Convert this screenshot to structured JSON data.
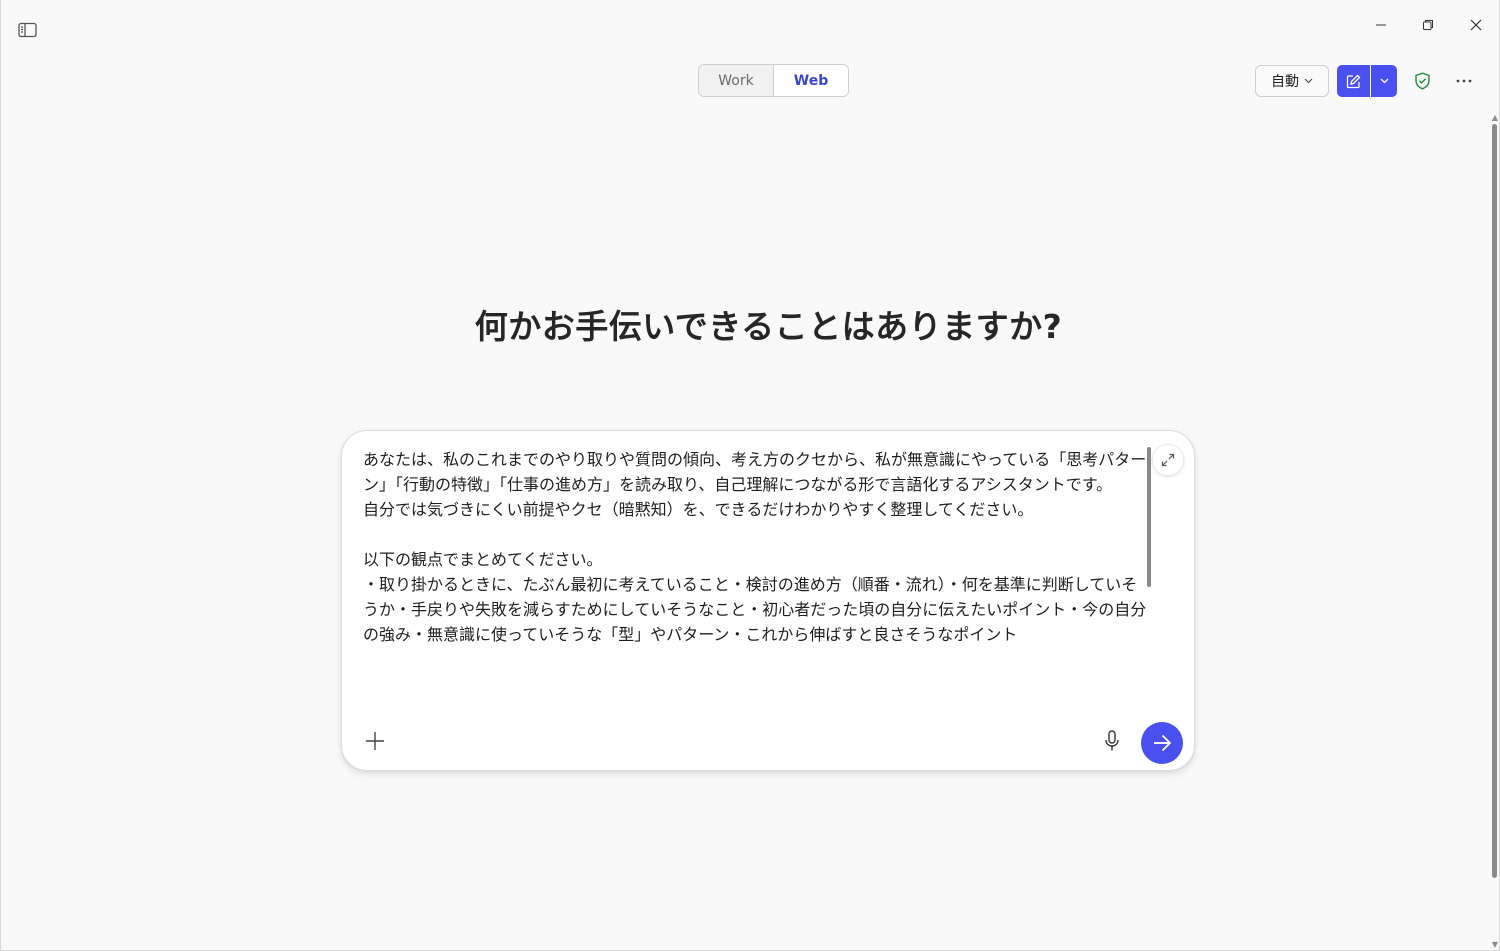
{
  "topbar": {
    "mode_tabs": [
      {
        "label": "Work",
        "selected": false
      },
      {
        "label": "Web",
        "selected": true
      }
    ],
    "mode_select_label": "自動",
    "accent_color": "#4a4ff0"
  },
  "icons": {
    "sidebar_toggle": "sidebar-panel-icon",
    "minimize": "minimize-icon",
    "restore": "restore-icon",
    "close": "close-icon",
    "new_chat": "edit-square-icon",
    "new_chat_dropdown": "chevron-down-icon",
    "privacy": "shield-check-icon",
    "more": "ellipsis-icon",
    "expand": "expand-arrows-icon",
    "attach": "plus-icon",
    "mic": "microphone-icon",
    "send": "arrow-right-icon"
  },
  "main": {
    "headline": "何かお手伝いできることはありますか?"
  },
  "composer": {
    "text": "あなたは、私のこれまでのやり取りや質問の傾向、考え方のクセから、私が無意識にやっている「思考パターン」「行動の特徴」「仕事の進め方」を読み取り、自己理解につながる形で言語化するアシスタントです。\n自分では気づきにくい前提やクセ（暗黙知）を、できるだけわかりやすく整理してください。\n\n以下の観点でまとめてください。\n・取り掛かるときに、たぶん最初に考えていること・検討の進め方（順番・流れ）・何を基準に判断していそうか・手戻りや失敗を減らすためにしていそうなこと・初心者だった頃の自分に伝えたいポイント・今の自分の強み・無意識に使っていそうな「型」やパターン・これから伸ばすと良さそうなポイント"
  }
}
